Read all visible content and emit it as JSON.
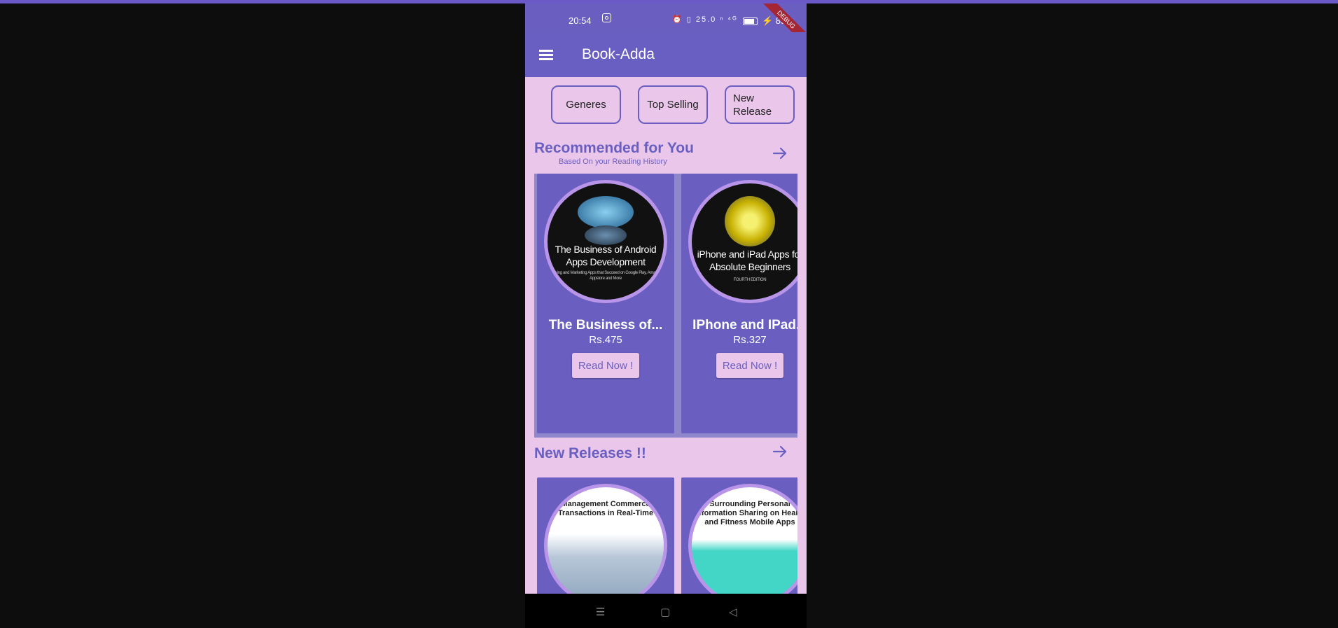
{
  "status_bar": {
    "time": "20:54",
    "icons_text": "⏰ ▯ 25.0 ⁿ ⁴ᴳ",
    "battery_text": "⚡ 89"
  },
  "debug_banner": "DEBUG",
  "app_bar": {
    "title": "Book-Adda",
    "menu_icon": "hamburger-menu-icon"
  },
  "chips": [
    "Generes",
    "Top Selling",
    "New Release"
  ],
  "recommended": {
    "title": "Recommended for You",
    "subtitle": "Based On your Reading History",
    "books": [
      {
        "cover_text": "The Business of Android Apps Development",
        "cover_small": "Making and Marketing Apps that Succeed on Google Play, Amazon Appstore and More",
        "title": "The Business of...",
        "price": "Rs.475",
        "button": "Read Now !"
      },
      {
        "cover_text": "iPhone and iPad Apps for Absolute Beginners",
        "cover_small": "FOURTH EDITION",
        "title": "IPhone and IPad...",
        "price": "Rs.327",
        "button": "Read Now !"
      }
    ]
  },
  "new_releases": {
    "title": "New Releases !!",
    "books": [
      {
        "cover_text": "Management Commerce Transactions in Real-Time"
      },
      {
        "cover_text": "Surrounding Personal Information Sharing on Health and Fitness Mobile Apps"
      }
    ]
  },
  "nav_bar": {
    "menu": "☰",
    "home": "▢",
    "back": "◁"
  },
  "colors": {
    "primary": "#6a5fc1",
    "background": "#e9c6ea",
    "cover_border": "#b995e9"
  }
}
